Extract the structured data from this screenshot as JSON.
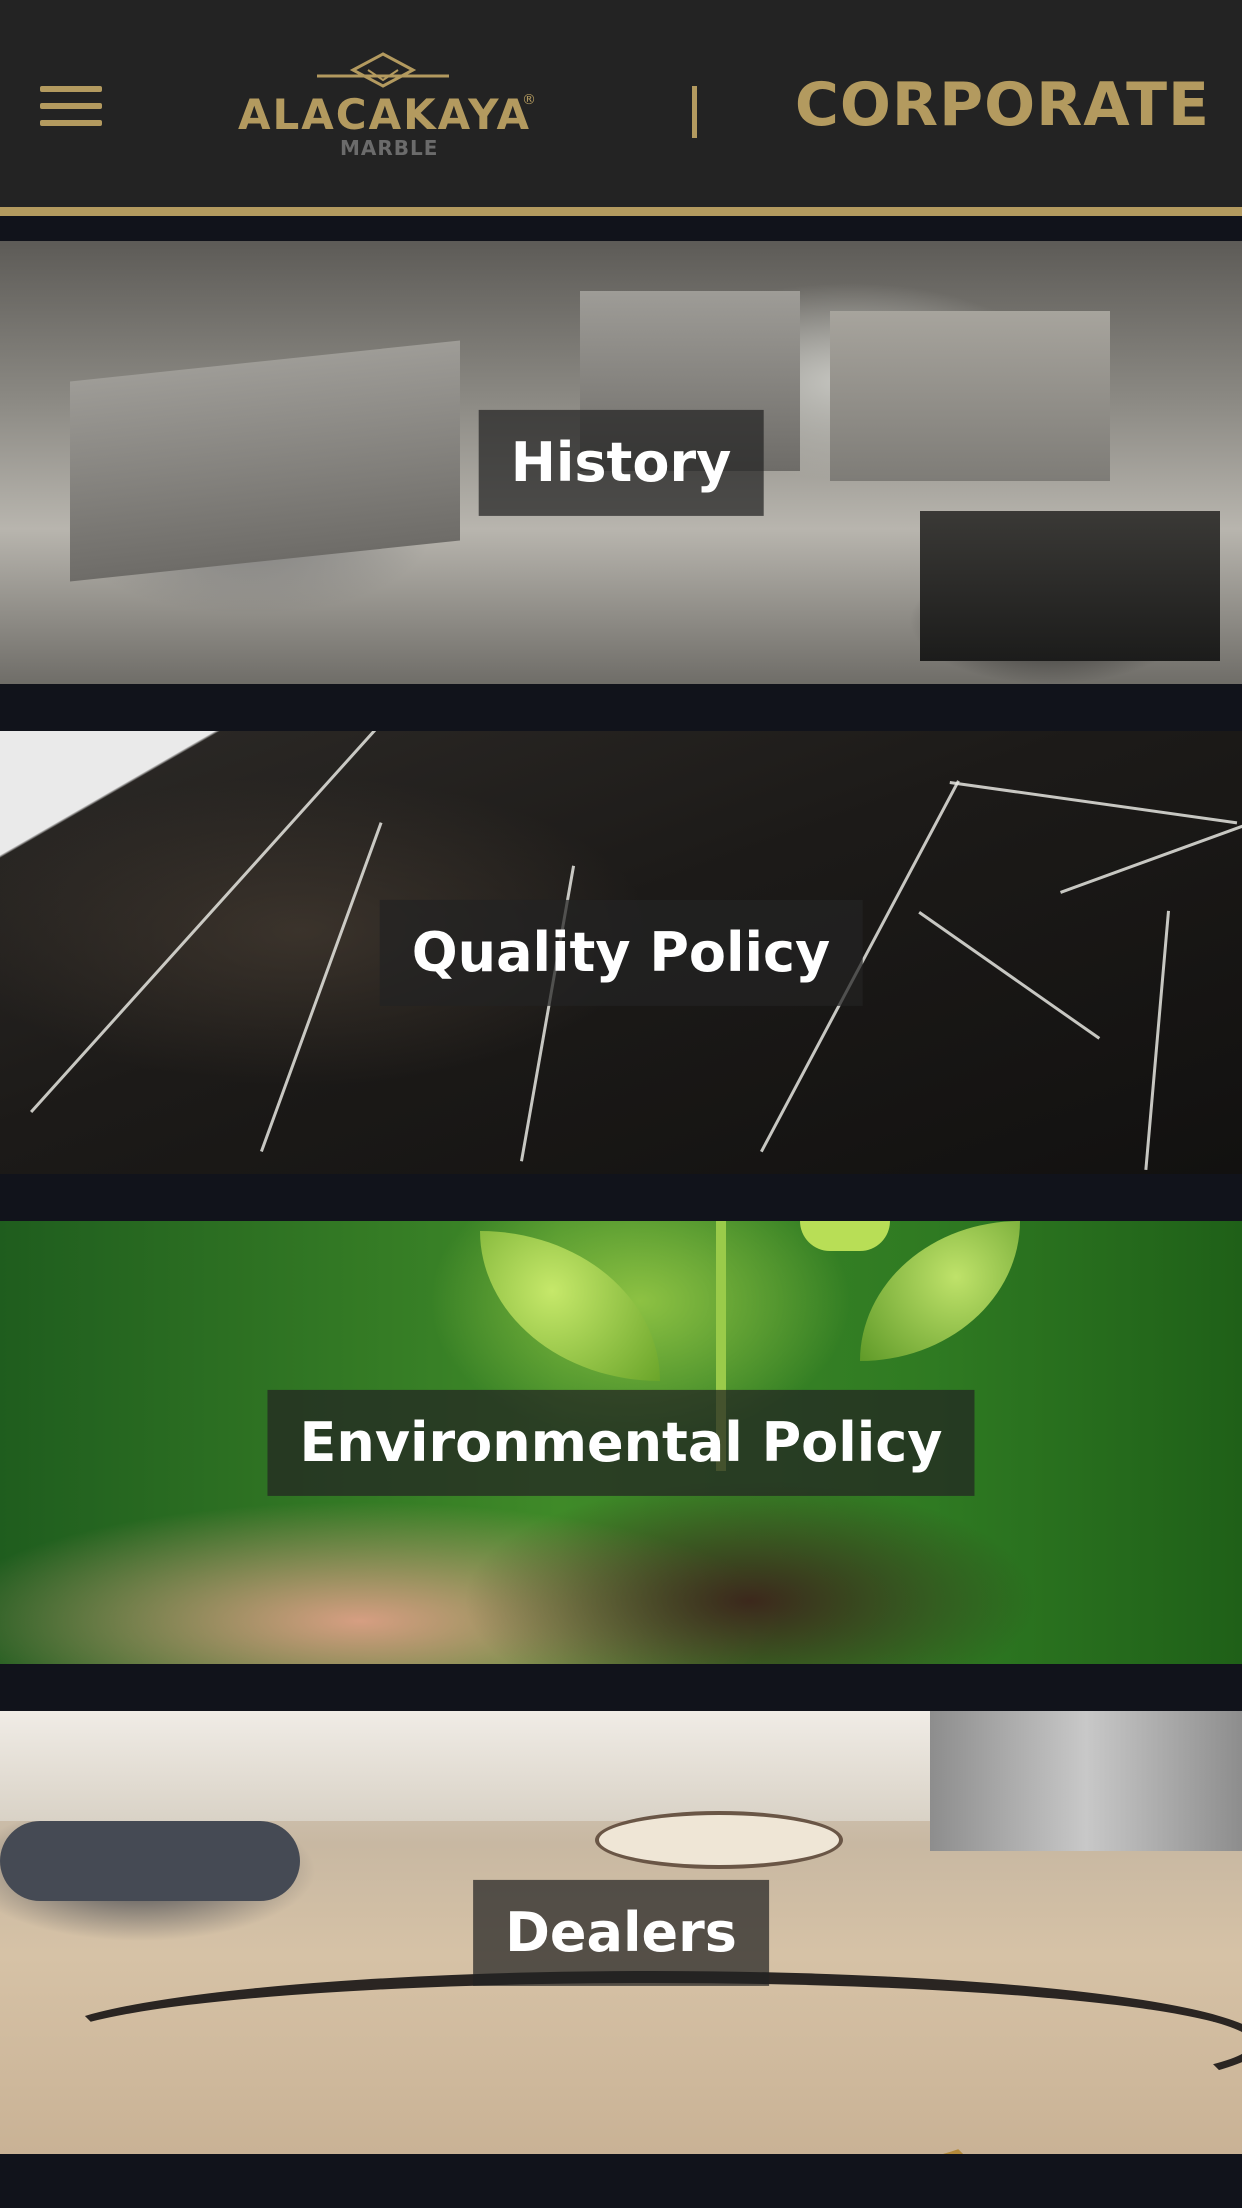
{
  "header": {
    "menu_icon": "hamburger-menu-icon",
    "logo_name": "ALACAKAYA",
    "logo_registered": "®",
    "logo_sub": "MARBLE",
    "title": "CORPORATE"
  },
  "colors": {
    "accent": "#b39a5f",
    "header_bg": "#232323",
    "page_bg": "#11131b",
    "label_bg": "rgba(34,34,34,0.72)",
    "label_text": "#ffffff"
  },
  "cards": [
    {
      "label": "History",
      "image": "black-and-white marble quarry photo"
    },
    {
      "label": "Quality Policy",
      "image": "black marble with white veins"
    },
    {
      "label": "Environmental Policy",
      "image": "hand holding soil with seedling"
    },
    {
      "label": "Dealers",
      "image": "marble-floored hotel lobby"
    }
  ]
}
